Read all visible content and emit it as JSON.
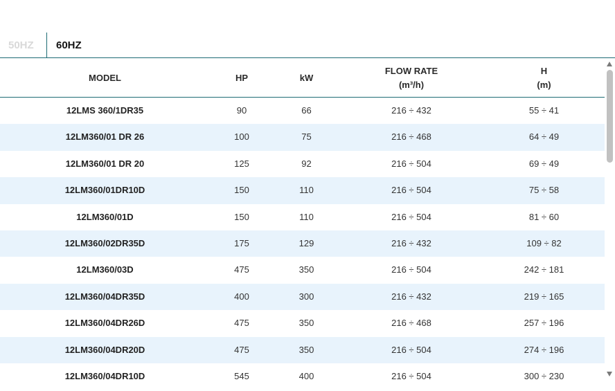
{
  "tabs": [
    {
      "label": "50HZ",
      "active": false
    },
    {
      "label": "60HZ",
      "active": true
    }
  ],
  "table": {
    "headers": {
      "model": "MODEL",
      "hp": "HP",
      "kw": "kW",
      "flow_line1": "FLOW RATE",
      "flow_line2": "(m³/h)",
      "h_line1": "H",
      "h_line2": "(m)"
    },
    "rows": [
      {
        "model": "12LMS 360/1DR35",
        "hp": "90",
        "kw": "66",
        "flow": "216 ÷ 432",
        "h": "55 ÷ 41"
      },
      {
        "model": "12LM360/01 DR 26",
        "hp": "100",
        "kw": "75",
        "flow": "216 ÷ 468",
        "h": "64 ÷ 49"
      },
      {
        "model": "12LM360/01 DR 20",
        "hp": "125",
        "kw": "92",
        "flow": "216 ÷ 504",
        "h": "69 ÷ 49"
      },
      {
        "model": "12LM360/01DR10D",
        "hp": "150",
        "kw": "110",
        "flow": "216 ÷ 504",
        "h": "75 ÷ 58"
      },
      {
        "model": "12LM360/01D",
        "hp": "150",
        "kw": "110",
        "flow": "216 ÷ 504",
        "h": "81 ÷ 60"
      },
      {
        "model": "12LM360/02DR35D",
        "hp": "175",
        "kw": "129",
        "flow": "216 ÷ 432",
        "h": "109 ÷ 82"
      },
      {
        "model": "12LM360/03D",
        "hp": "475",
        "kw": "350",
        "flow": "216 ÷ 504",
        "h": "242 ÷ 181"
      },
      {
        "model": "12LM360/04DR35D",
        "hp": "400",
        "kw": "300",
        "flow": "216 ÷ 432",
        "h": "219 ÷ 165"
      },
      {
        "model": "12LM360/04DR26D",
        "hp": "475",
        "kw": "350",
        "flow": "216 ÷ 468",
        "h": "257 ÷ 196"
      },
      {
        "model": "12LM360/04DR20D",
        "hp": "475",
        "kw": "350",
        "flow": "216 ÷ 504",
        "h": "274 ÷ 196"
      },
      {
        "model": "12LM360/04DR10D",
        "hp": "545",
        "kw": "400",
        "flow": "216 ÷ 504",
        "h": "300 ÷ 230"
      }
    ]
  },
  "colors": {
    "accent": "#1d6b74",
    "row_alt": "#e8f3fc",
    "inactive_tab": "#d9d9d9",
    "scroll_thumb": "#c1c1c1"
  },
  "icons": {
    "scroll_up": "triangle-up-icon",
    "scroll_down": "triangle-down-icon"
  }
}
